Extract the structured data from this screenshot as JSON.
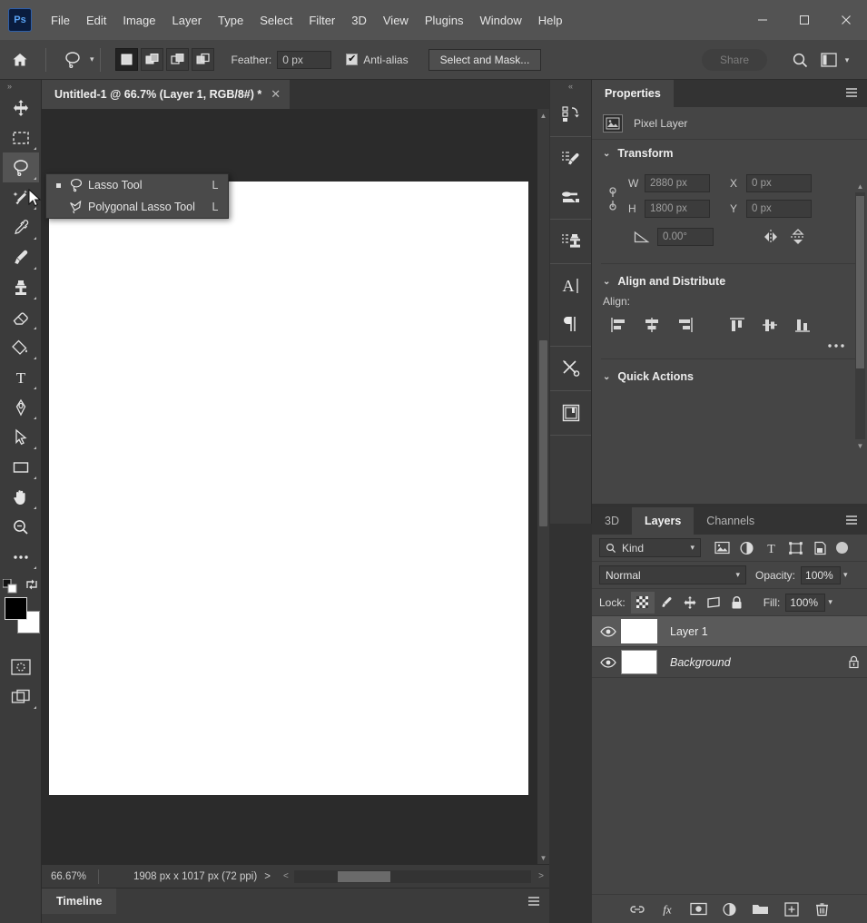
{
  "app": {
    "name": "Adobe Photoshop",
    "logo_text": "Ps"
  },
  "menubar": {
    "items": [
      {
        "label": "File"
      },
      {
        "label": "Edit"
      },
      {
        "label": "Image"
      },
      {
        "label": "Layer"
      },
      {
        "label": "Type"
      },
      {
        "label": "Select"
      },
      {
        "label": "Filter"
      },
      {
        "label": "3D"
      },
      {
        "label": "View"
      },
      {
        "label": "Plugins"
      },
      {
        "label": "Window"
      },
      {
        "label": "Help"
      }
    ],
    "window_controls": {
      "minimize": "minimize-icon",
      "maximize": "maximize-icon",
      "close": "close-icon"
    }
  },
  "options_bar": {
    "home_icon": "home-icon",
    "active_tool_icon": "lasso-icon",
    "tool_preset_caret": "chevron-down-icon",
    "selection_modes": [
      {
        "name": "new-selection",
        "active": true
      },
      {
        "name": "add-to-selection",
        "active": false
      },
      {
        "name": "subtract-from-selection",
        "active": false
      },
      {
        "name": "intersect-with-selection",
        "active": false
      }
    ],
    "feather_label": "Feather:",
    "feather_value": "0 px",
    "antialias_label": "Anti-alias",
    "antialias_checked": true,
    "select_and_mask_label": "Select and Mask...",
    "share_label": "Share",
    "share_disabled": true,
    "search_icon": "search-icon",
    "workspace_icon": "workspace-icon",
    "workspace_caret": "chevron-down-icon"
  },
  "toolbar": {
    "collapse_icon": "double-chevron-right-icon",
    "tools": [
      {
        "name": "move-tool",
        "icon": "move-icon",
        "has_more": false
      },
      {
        "name": "rectangular-marquee-tool",
        "icon": "marquee-icon",
        "has_more": true
      },
      {
        "name": "lasso-tool",
        "icon": "lasso-icon",
        "has_more": true,
        "active": true
      },
      {
        "name": "object-selection-tool",
        "icon": "magic-wand-icon",
        "has_more": true
      },
      {
        "name": "eyedropper-tool",
        "icon": "eyedropper-icon",
        "has_more": true
      },
      {
        "name": "brush-tool",
        "icon": "brush-icon",
        "has_more": true
      },
      {
        "name": "clone-stamp-tool",
        "icon": "clone-stamp-icon",
        "has_more": true
      },
      {
        "name": "eraser-tool",
        "icon": "eraser-icon",
        "has_more": true
      },
      {
        "name": "gradient-tool",
        "icon": "paint-bucket-icon",
        "has_more": true
      },
      {
        "name": "type-tool",
        "icon": "type-icon",
        "has_more": true
      },
      {
        "name": "pen-tool",
        "icon": "pen-icon",
        "has_more": true
      },
      {
        "name": "path-selection-tool",
        "icon": "path-arrow-icon",
        "has_more": true
      },
      {
        "name": "rectangle-tool",
        "icon": "rectangle-icon",
        "has_more": true
      },
      {
        "name": "hand-tool",
        "icon": "hand-icon",
        "has_more": true
      },
      {
        "name": "zoom-tool",
        "icon": "zoom-icon",
        "has_more": false
      },
      {
        "name": "edit-toolbar",
        "icon": "ellipsis-icon",
        "has_more": true
      }
    ],
    "default_colors_icon": "default-colors-icon",
    "swap_colors_icon": "swap-colors-icon",
    "foreground_color": "#000000",
    "background_color": "#ffffff",
    "quick_mask_icon": "quick-mask-icon",
    "screen_mode_icon": "screen-mode-icon"
  },
  "tool_flyout": {
    "items": [
      {
        "label": "Lasso Tool",
        "shortcut": "L",
        "icon": "lasso-icon",
        "selected": true
      },
      {
        "label": "Polygonal Lasso Tool",
        "shortcut": "L",
        "icon": "polygonal-lasso-icon",
        "selected": false
      }
    ]
  },
  "document": {
    "tab_title": "Untitled-1 @ 66.7% (Layer 1, RGB/8#) *",
    "close_icon": "close-icon"
  },
  "status_bar": {
    "zoom": "66.67%",
    "dimensions": "1908 px x 1017 px (72 ppi)",
    "expand_arrow": ">",
    "scroll_left_arrow": "<",
    "scroll_right_arrow": ">"
  },
  "timeline": {
    "tab_label": "Timeline",
    "menu_icon": "panel-menu-icon"
  },
  "icon_dock": {
    "collapse_icon": "double-chevron-left-icon",
    "groups": [
      [
        {
          "name": "history-panel-icon"
        }
      ],
      [
        {
          "name": "brush-settings-panel-icon"
        },
        {
          "name": "brushes-panel-icon"
        }
      ],
      [
        {
          "name": "clone-source-panel-icon"
        }
      ],
      [
        {
          "name": "character-panel-icon"
        },
        {
          "name": "paragraph-panel-icon"
        }
      ],
      [
        {
          "name": "tool-presets-panel-icon"
        }
      ],
      [
        {
          "name": "libraries-panel-icon"
        }
      ]
    ]
  },
  "properties_panel": {
    "tabs": [
      {
        "label": "Properties",
        "active": true
      }
    ],
    "menu_icon": "panel-menu-icon",
    "layer_type_icon": "pixel-layer-icon",
    "layer_type": "Pixel Layer",
    "transform": {
      "title": "Transform",
      "collapsed": false,
      "link_icon": "link-aspect-icon",
      "w_label": "W",
      "w_value": "2880 px",
      "h_label": "H",
      "h_value": "1800 px",
      "x_label": "X",
      "x_value": "0 px",
      "y_label": "Y",
      "y_value": "0 px",
      "angle_icon": "angle-icon",
      "angle_value": "0.00°",
      "flip_horizontal_icon": "flip-horizontal-icon",
      "flip_vertical_icon": "flip-vertical-icon"
    },
    "align_distribute": {
      "title": "Align and Distribute",
      "align_label": "Align:",
      "buttons": [
        {
          "name": "align-left-edges"
        },
        {
          "name": "align-horizontal-centers"
        },
        {
          "name": "align-right-edges"
        },
        {
          "name": "align-top-edges"
        },
        {
          "name": "align-vertical-centers"
        },
        {
          "name": "align-bottom-edges"
        }
      ],
      "more_icon": "ellipsis-icon"
    },
    "quick_actions": {
      "title": "Quick Actions",
      "collapsed": false
    }
  },
  "layers_panel": {
    "tabs": [
      {
        "label": "3D",
        "active": false
      },
      {
        "label": "Layers",
        "active": true
      },
      {
        "label": "Channels",
        "active": false
      }
    ],
    "menu_icon": "panel-menu-icon",
    "filter": {
      "search_icon": "search-icon",
      "kind_label": "Kind",
      "caret": "chevron-down-icon",
      "type_filters": [
        {
          "name": "filter-pixel-layers-icon"
        },
        {
          "name": "filter-adjustment-layers-icon"
        },
        {
          "name": "filter-type-layers-icon"
        },
        {
          "name": "filter-shape-layers-icon"
        },
        {
          "name": "filter-smart-objects-icon"
        }
      ],
      "toggle_name": "filter-enable-toggle"
    },
    "blend_mode": "Normal",
    "blend_caret": "chevron-down-icon",
    "opacity_label": "Opacity:",
    "opacity_value": "100%",
    "lock_label": "Lock:",
    "lock_buttons": [
      {
        "name": "lock-transparent-pixels-icon",
        "active": true
      },
      {
        "name": "lock-image-pixels-icon",
        "active": false
      },
      {
        "name": "lock-position-icon",
        "active": false
      },
      {
        "name": "lock-artboard-nesting-icon",
        "active": false
      },
      {
        "name": "lock-all-icon",
        "active": false
      }
    ],
    "fill_label": "Fill:",
    "fill_value": "100%",
    "layers": [
      {
        "name": "Layer 1",
        "visible": true,
        "selected": true,
        "thumbnail": "transparent",
        "locked": false,
        "italic": false
      },
      {
        "name": "Background",
        "visible": true,
        "selected": false,
        "thumbnail": "white",
        "locked": true,
        "italic": true
      }
    ],
    "footer_buttons": [
      {
        "name": "link-layers-icon",
        "label": "link"
      },
      {
        "name": "layer-style-fx-icon",
        "label": "fx"
      },
      {
        "name": "add-layer-mask-icon",
        "label": "mask"
      },
      {
        "name": "new-adjustment-layer-icon",
        "label": "adjustment"
      },
      {
        "name": "new-group-icon",
        "label": "group"
      },
      {
        "name": "new-layer-icon",
        "label": "new"
      },
      {
        "name": "delete-layer-icon",
        "label": "delete"
      }
    ]
  },
  "colors": {
    "menubar_bg": "#535353",
    "options_bg": "#454545",
    "panel_bg": "#454545",
    "tab_bg": "#333333",
    "canvas_bg": "#2b2b2b",
    "canvas_white": "#ffffff",
    "selection_highlight": "#5a5a5a",
    "accent_blue": "#5ba4f5"
  }
}
